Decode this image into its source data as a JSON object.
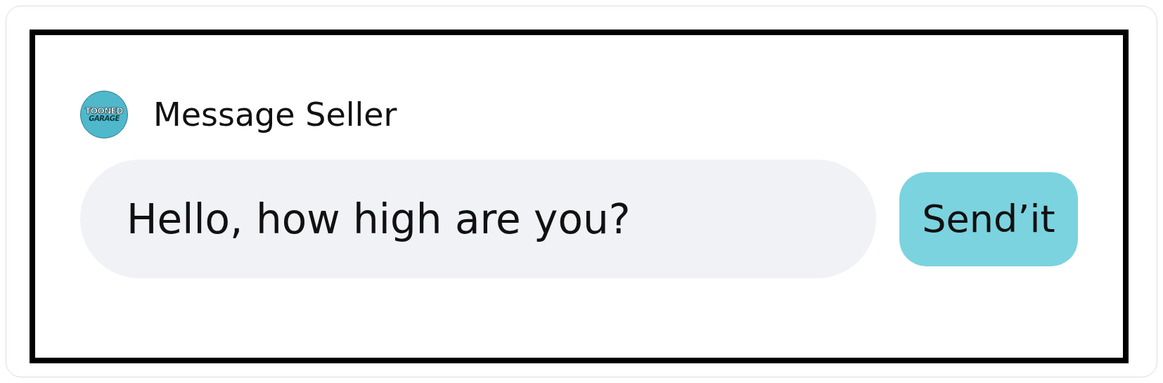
{
  "logo": {
    "line_1": "TOONED",
    "line_2": "GARAGE"
  },
  "title": "Message Seller",
  "message_field": {
    "value": "Hello, how high are you?"
  },
  "send_button": {
    "label": "Send’it"
  }
}
